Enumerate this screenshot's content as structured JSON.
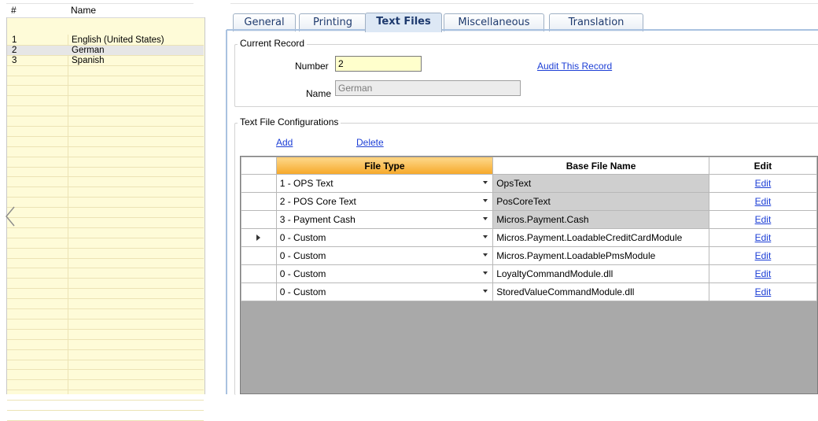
{
  "left_list": {
    "headers": {
      "id": "#",
      "name": "Name"
    },
    "rows": [
      {
        "id": "1",
        "name": "English (United States)"
      },
      {
        "id": "2",
        "name": "German"
      },
      {
        "id": "3",
        "name": "Spanish"
      }
    ],
    "selected_row": 2
  },
  "tabs": [
    {
      "label": "General"
    },
    {
      "label": "Printing"
    },
    {
      "label": "Text Files"
    },
    {
      "label": "Miscellaneous"
    },
    {
      "label": "Translation"
    }
  ],
  "active_tab": "Text Files",
  "current_record": {
    "title": "Current Record",
    "number_label": "Number",
    "number_value": "2",
    "name_label": "Name",
    "name_value": "German",
    "audit_link": "Audit This Record"
  },
  "text_file_config": {
    "title": "Text File Configurations",
    "add_link": "Add",
    "delete_link": "Delete",
    "columns": {
      "file_type": "File Type",
      "base_file_name": "Base File Name",
      "edit": "Edit"
    },
    "rows": [
      {
        "file_type": "1 - OPS Text",
        "base_file_name": "OpsText",
        "edit": "Edit",
        "readonly": true
      },
      {
        "file_type": "2 - POS Core Text",
        "base_file_name": "PosCoreText",
        "edit": "Edit",
        "readonly": true
      },
      {
        "file_type": "3 - Payment Cash",
        "base_file_name": "Micros.Payment.Cash",
        "edit": "Edit",
        "readonly": true
      },
      {
        "file_type": "0 - Custom",
        "base_file_name": "Micros.Payment.LoadableCreditCardModule",
        "edit": "Edit",
        "readonly": false,
        "current": true
      },
      {
        "file_type": "0 - Custom",
        "base_file_name": "Micros.Payment.LoadablePmsModule",
        "edit": "Edit",
        "readonly": false
      },
      {
        "file_type": "0 - Custom",
        "base_file_name": "LoyaltyCommandModule.dll",
        "edit": "Edit",
        "readonly": false
      },
      {
        "file_type": "0 - Custom",
        "base_file_name": "StoredValueCommandModule.dll",
        "edit": "Edit",
        "readonly": false
      }
    ]
  },
  "colors": {
    "list_background": "#fefbd8",
    "sorted_header": "#f6a828",
    "link": "#1d3fd6",
    "tab_border": "#a9c2e0",
    "readonly_cell": "#cfcfcf"
  }
}
